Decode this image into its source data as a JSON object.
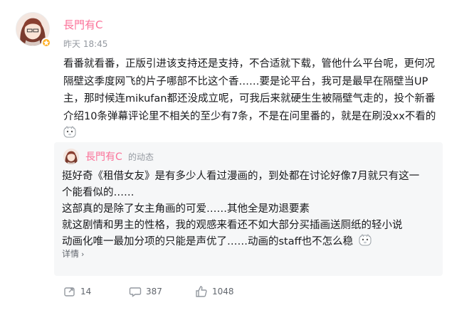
{
  "post": {
    "author": "長門有C",
    "time": "昨天 18:45",
    "content_lines": [
      "看番就看番，正版引进该支持还是支持，不合适就下载，管他什么平台呢，更何况",
      "隔壁这季度网飞的片子哪部不比这个香……要是论平台，我可是最早在隔壁当UP",
      "主，那时候连mikufan都还没成立呢，可我后来就硬生生被隔壁气走的，投个新番",
      "介绍10条弹幕评论里不相关的至少有7条，不是在问里番的，就是在刷没xx不看的"
    ],
    "emoji_name": "doge-emoji"
  },
  "forward": {
    "author": "長門有C",
    "suffix": "的动态",
    "content_lines": [
      "挺好奇《租借女友》是有多少人看过漫画的，到处都在讨论好像7月就只有这一",
      "个能看似的……",
      "这部真的是除了女主角画的可爱……其他全是劝退要素",
      "就这剧情和男主的性格，我的观感来看还不如大部分买插画送厕纸的轻小说",
      "动画化唯一最加分项的只能是声优了……动画的staff也不怎么稳"
    ],
    "more_label": "详情"
  },
  "actions": {
    "forward_count": "14",
    "comment_count": "387",
    "like_count": "1048"
  },
  "colors": {
    "author": "#fb7299",
    "muted": "#9499a0",
    "card_bg": "#f6f7f8",
    "badge": "#ffb027"
  }
}
